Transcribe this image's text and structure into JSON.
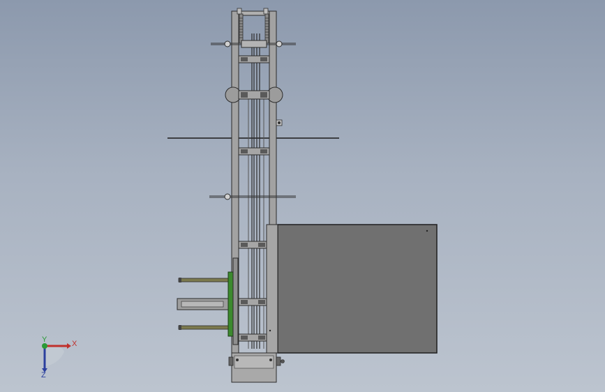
{
  "viewport": {
    "background_top": "#8c99ad",
    "background_bottom": "#bcc4cf"
  },
  "model": {
    "frame_color": "#9a9a9a",
    "frame_edge": "#2b2b2b",
    "panel_color": "#707070",
    "gear_color": "#3c8a2e",
    "rod_color": "#7c7a4e"
  },
  "triad": {
    "x_label": "X",
    "y_label": "Y",
    "z_label": "Z",
    "x_color": "#c0302c",
    "y_color": "#2a9a36",
    "z_color": "#2b3f9e"
  }
}
